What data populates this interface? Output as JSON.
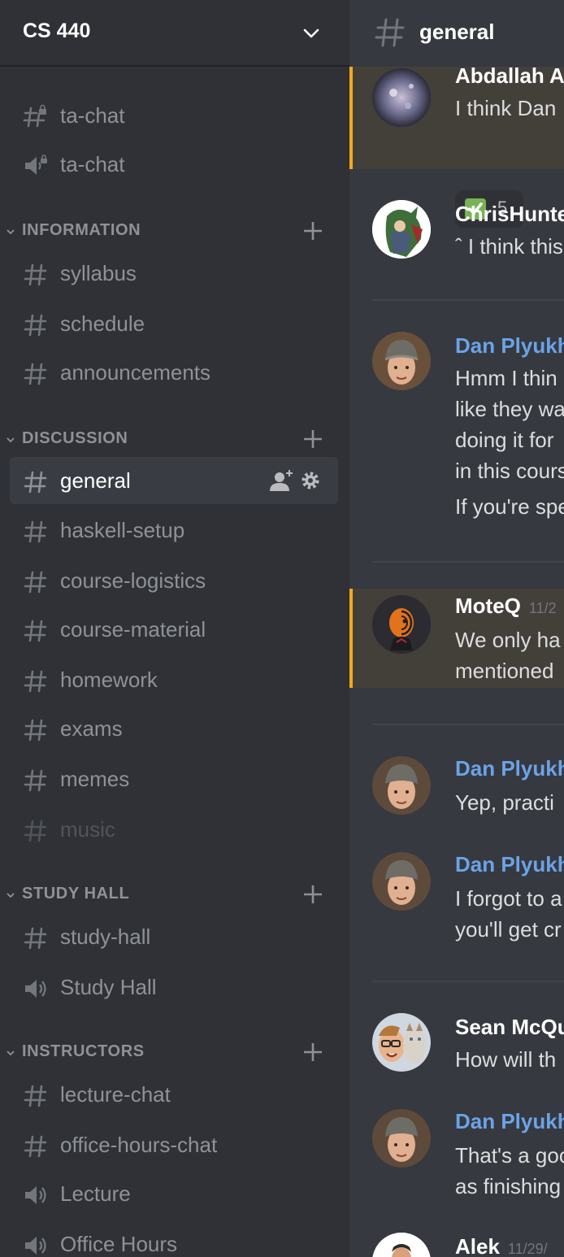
{
  "server": {
    "name": "CS 440"
  },
  "sidebar": {
    "top_channels": [
      {
        "label": "ta-chat",
        "icon": "locked-hash-icon"
      },
      {
        "label": "ta-chat",
        "icon": "locked-speaker-icon"
      }
    ],
    "categories": {
      "information": {
        "label": "INFORMATION",
        "channels": [
          "syllabus",
          "schedule",
          "announcements"
        ]
      },
      "discussion": {
        "label": "DISCUSSION",
        "channels": [
          "general",
          "haskell-setup",
          "course-logistics",
          "course-material",
          "homework",
          "exams",
          "memes",
          "music"
        ],
        "active": "general"
      },
      "study_hall": {
        "label": "STUDY HALL",
        "channels": [
          "study-hall",
          "Study Hall"
        ]
      },
      "instructors": {
        "label": "INSTRUCTORS",
        "channels": [
          "lecture-chat",
          "office-hours-chat",
          "Lecture",
          "Office Hours"
        ]
      }
    }
  },
  "chat": {
    "channel": "general",
    "messages": [
      {
        "author": "Abdallah A",
        "lines": [
          "I think Dan"
        ],
        "mention": true,
        "reaction": {
          "emoji": "check-mark-icon",
          "count": "5"
        }
      },
      {
        "author": "ChrisHunte",
        "lines": [
          "ˆ I think this"
        ]
      },
      {
        "author": "Dan Plyukh",
        "lines": [
          "Hmm I thin",
          "like they wa",
          "doing it for",
          "in this cours",
          "If you're spe"
        ]
      },
      {
        "author": "MoteQ",
        "timestamp": "11/2",
        "lines": [
          "We only ha",
          "mentioned"
        ],
        "mention": true
      },
      {
        "author": "Dan Plyukh",
        "lines": [
          "Yep,  practi"
        ]
      },
      {
        "author": "Dan Plyukh",
        "lines": [
          "I forgot to a",
          "you'll get cr"
        ]
      },
      {
        "author": "Sean McQu",
        "lines": [
          "How will th"
        ]
      },
      {
        "author": "Dan Plyukh",
        "lines": [
          "That's a goo",
          "as finishing"
        ]
      },
      {
        "author": "Alek",
        "timestamp": "11/29/",
        "lines": []
      }
    ]
  },
  "colors": {
    "sidebar_bg": "#2f3136",
    "chat_bg": "#36393f",
    "mention_accent": "#faa81a",
    "staff_name": "#6ba3e8"
  }
}
